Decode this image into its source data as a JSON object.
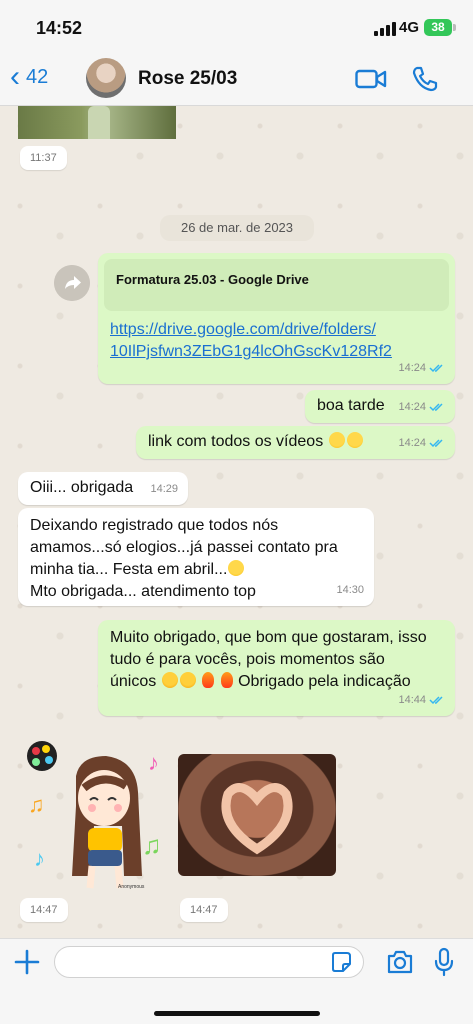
{
  "status": {
    "time": "14:52",
    "network": "4G",
    "battery": "38"
  },
  "header": {
    "back_count": "42",
    "contact_name": "Rose 25/03"
  },
  "chat": {
    "first_stamp": "11:37",
    "date_divider": "26 de mar. de 2023",
    "link_message": {
      "card_title": "Formatura 25.03 - Google Drive",
      "url_line1": "https://drive.google.com/drive/folders/",
      "url_line2": "10IlPjsfwn3ZEbG1g4lcOhGscKv128Rf2",
      "time": "14:24"
    },
    "msg_boa_tarde": {
      "text": "boa tarde",
      "time": "14:24"
    },
    "msg_link_videos": {
      "text": "link com todos os vídeos",
      "time": "14:24"
    },
    "msg_obrigada": {
      "text": "Oiii... obrigada",
      "time": "14:29"
    },
    "msg_registrado": {
      "line1": "Deixando registrado que todos nós",
      "line2": "amamos...só elogios...já passei contato pra",
      "line3": "minha tia... Festa em abril...",
      "line4": "Mto obrigada... atendimento top",
      "time": "14:30"
    },
    "msg_muito_obrigado": {
      "line1": "Muito obrigado, que bom que gostaram, isso",
      "line2": "tudo é para vocês, pois momentos são",
      "line3a": "únicos",
      "line3b": "Obrigado pela indicação",
      "time": "14:44"
    },
    "sticker1_time": "14:47",
    "sticker2_time": "14:47",
    "sticker_label": "Anonymous"
  },
  "composer": {
    "placeholder": ""
  },
  "colors": {
    "accent": "#1a7cd5",
    "outgoing_bubble": "#dcf8c6",
    "read_ticks": "#34b7f1"
  }
}
